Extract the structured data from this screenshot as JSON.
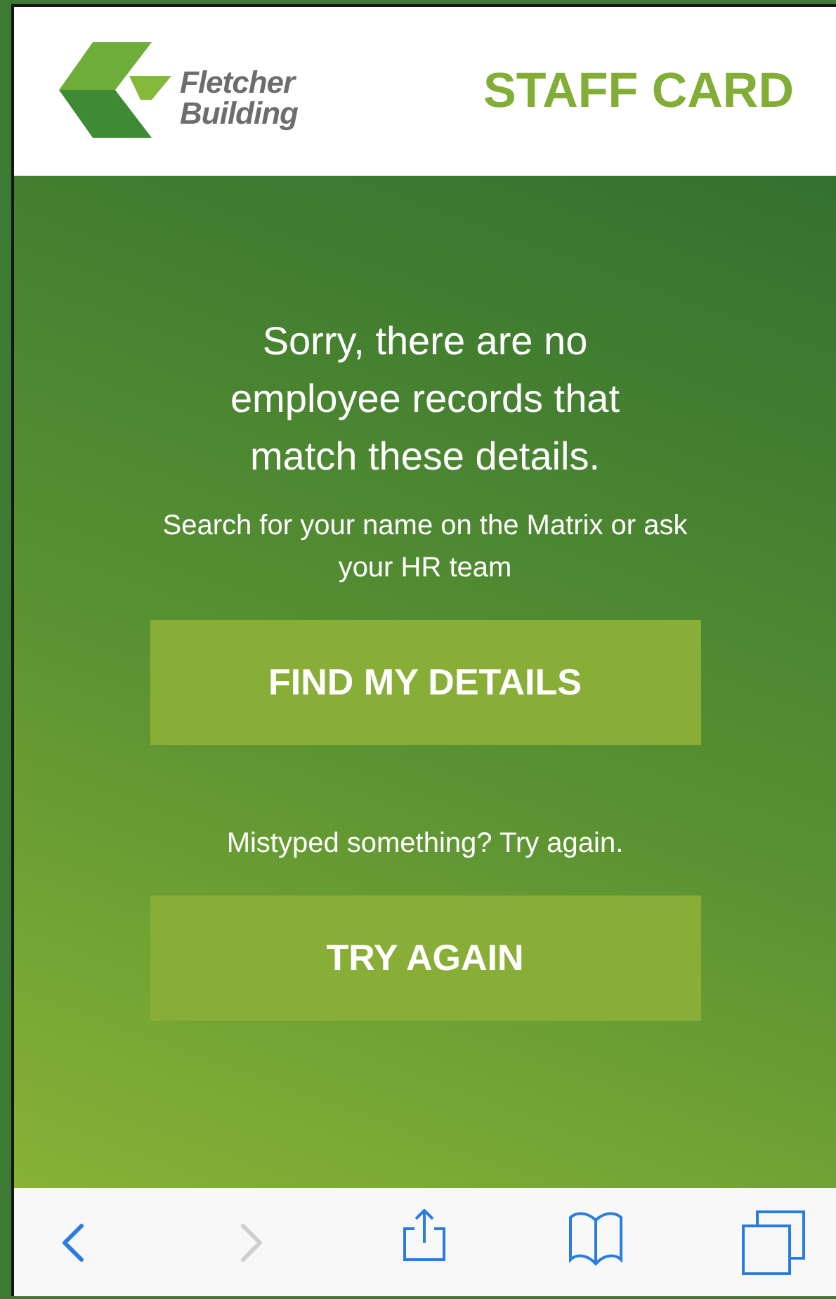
{
  "header": {
    "logo_line_1": "Fletcher",
    "logo_line_2": "Building",
    "title": "STAFF CARD"
  },
  "message": {
    "heading": "Sorry, there are no employee records that match these details.",
    "hint": "Search for your name on the Matrix or ask your HR team"
  },
  "actions": [
    {
      "label": "FIND MY DETAILS"
    },
    {
      "prompt": "Mistyped something? Try again.",
      "label": "TRY AGAIN"
    }
  ],
  "toolbar": [
    {
      "kind": "back",
      "disabled": false
    },
    {
      "kind": "forward",
      "disabled": true
    },
    {
      "kind": "share",
      "disabled": false
    },
    {
      "kind": "bookmarks",
      "disabled": false
    },
    {
      "kind": "tabs",
      "disabled": false
    }
  ]
}
